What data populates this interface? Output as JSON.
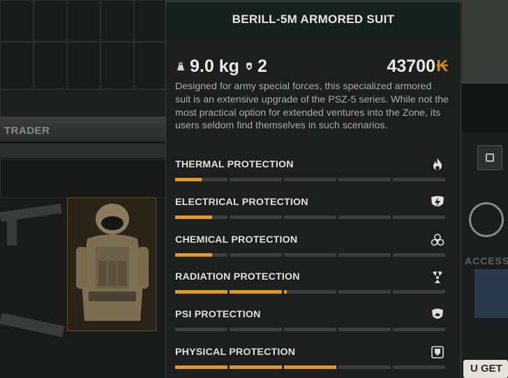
{
  "background": {
    "trader_label": "TRADER",
    "access_label": "ACCESS",
    "get_label": "U GET"
  },
  "tooltip": {
    "title": "BERILL-5M ARMORED SUIT",
    "weight": "9.0 kg",
    "slots": "2",
    "price": "43700",
    "currency_symbol": "₭",
    "description": "Designed for army special forces, this specialized armored suit is an extensive upgrade of the PSZ-5 series. While not the most practical option for extended ventures into the Zone, its users seldom find themselves in such scenarios.",
    "protections": [
      {
        "label": "THERMAL PROTECTION",
        "icon": "flame-icon",
        "level": 0.5
      },
      {
        "label": "ELECTRICAL PROTECTION",
        "icon": "lightning-shield-icon",
        "level": 0.7
      },
      {
        "label": "CHEMICAL PROTECTION",
        "icon": "biohazard-icon",
        "level": 0.7
      },
      {
        "label": "RADIATION PROTECTION",
        "icon": "radiation-icon",
        "level": 2.05
      },
      {
        "label": "PSI PROTECTION",
        "icon": "psi-shield-icon",
        "level": 0
      },
      {
        "label": "PHYSICAL PROTECTION",
        "icon": "armor-icon",
        "level": 3.0
      }
    ],
    "segments_per_bar": 5
  },
  "colors": {
    "accent": "#e39a20",
    "currency": "#d68b17",
    "bar_empty": "#3c3f3e",
    "panel_bg": "#1c1f1e",
    "header_bg": "#16201c"
  }
}
